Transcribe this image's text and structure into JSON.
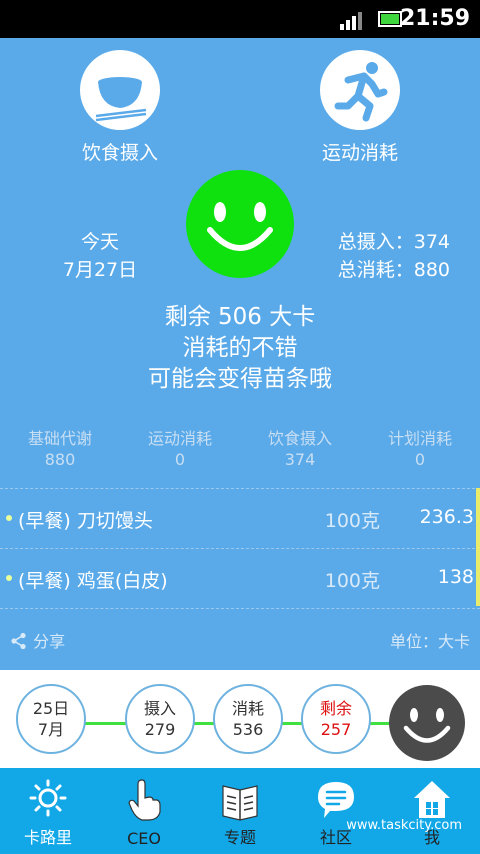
{
  "status": {
    "time": "21:59"
  },
  "top": {
    "diet_label": "饮食摄入",
    "exercise_label": "运动消耗"
  },
  "day": {
    "today": "今天",
    "date": "7月27日"
  },
  "totals": {
    "intake": "总摄入：374",
    "burn": "总消耗：880"
  },
  "message": {
    "line1": "剩余 506 大卡",
    "line2": "消耗的不错",
    "line3": "可能会变得苗条哦"
  },
  "stats": [
    {
      "label": "基础代谢",
      "value": "880"
    },
    {
      "label": "运动消耗",
      "value": "0"
    },
    {
      "label": "饮食摄入",
      "value": "374"
    },
    {
      "label": "计划消耗",
      "value": "0"
    }
  ],
  "foods": [
    {
      "name": "(早餐) 刀切馒头",
      "amount": "100克",
      "cal": "236.3"
    },
    {
      "name": "(早餐) 鸡蛋(白皮)",
      "amount": "100克",
      "cal": "138"
    }
  ],
  "footer": {
    "share": "分享",
    "unit": "单位：大卡"
  },
  "summary": [
    {
      "line1": "25日",
      "line2": "7月"
    },
    {
      "line1": "摄入",
      "line2": "279"
    },
    {
      "line1": "消耗",
      "line2": "536"
    },
    {
      "line1": "剩余",
      "line2": "257"
    }
  ],
  "tabs": [
    {
      "label": "卡路里",
      "icon": "sun-icon"
    },
    {
      "label": "CEO",
      "icon": "pointer-hand-icon"
    },
    {
      "label": "专题",
      "icon": "book-icon"
    },
    {
      "label": "社区",
      "icon": "chat-bubble-icon"
    },
    {
      "label": "我",
      "icon": "home-icon"
    }
  ],
  "watermark": "www.taskcity.com",
  "colors": {
    "main_bg": "#5aaaea",
    "smiley_green": "#0fe10f",
    "tab_bg": "#12a8e8",
    "remaining_red": "#dd1111"
  }
}
